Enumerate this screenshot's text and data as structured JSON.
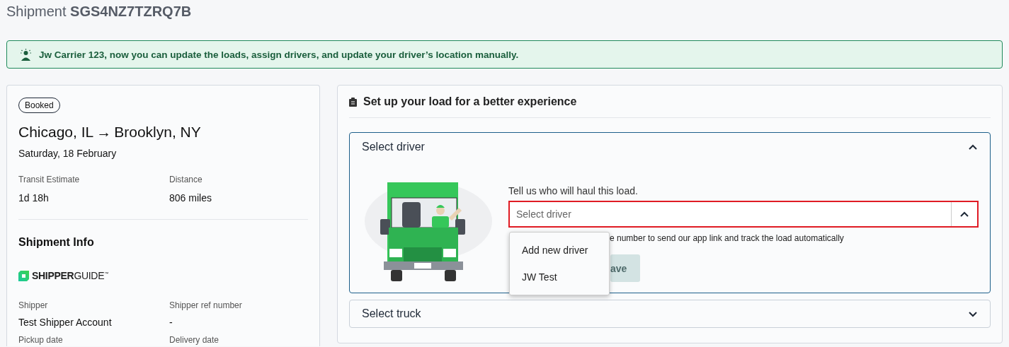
{
  "page": {
    "title_prefix": "Shipment",
    "shipment_id": "SGS4NZ7TZRQ7B"
  },
  "banner": {
    "text": "Jw Carrier 123, now you can update the loads, assign drivers, and update your driver’s location manually."
  },
  "summary": {
    "status": "Booked",
    "origin": "Chicago, IL",
    "arrow": "→",
    "destination": "Brooklyn, NY",
    "date": "Saturday, 18 February",
    "stats": [
      {
        "label": "Transit Estimate",
        "value": "1d 18h"
      },
      {
        "label": "Distance",
        "value": "806 miles"
      }
    ]
  },
  "shipment_info": {
    "title": "Shipment Info",
    "logo": {
      "bold": "SHIPPER",
      "light": "GUIDE",
      "mark": "™"
    },
    "fields": [
      {
        "label": "Shipper",
        "value": "Test Shipper Account"
      },
      {
        "label": "Shipper ref number",
        "value": "-"
      },
      {
        "label": "Pickup date"
      },
      {
        "label": "Delivery date"
      }
    ]
  },
  "setup": {
    "title": "Set up your load for a better experience",
    "sections": [
      {
        "kind": "driver",
        "title": "Select driver",
        "expanded": true,
        "prompt": "Tell us who will haul this load.",
        "select": {
          "placeholder": "Select driver",
          "open": true,
          "options": [
            {
              "label": "Add new driver",
              "selected": false
            },
            {
              "label": "JW Test",
              "selected": false
            }
          ]
        },
        "helper": "e number to send our app link and track the load automatically",
        "save_button": {
          "label": "ave",
          "disabled": true
        }
      },
      {
        "kind": "truck",
        "title": "Select truck",
        "expanded": false
      }
    ]
  }
}
